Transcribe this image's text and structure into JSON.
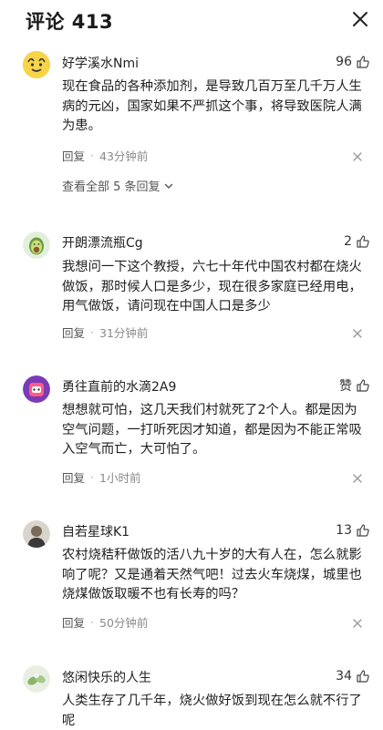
{
  "header": {
    "title": "评论 413"
  },
  "comments": [
    {
      "username": "好学溪水Nmi",
      "likes": "96",
      "text": "现在食品的各种添加剂，是导致几百万至几千万人生病的元凶，国家如果不严抓这个事，将导致医院人满为患。",
      "reply_label": "回复",
      "time": "43分钟前",
      "view_all": "查看全部 5 条回复"
    },
    {
      "username": "开朗漂流瓶Cg",
      "likes": "2",
      "text": "我想问一下这个教授，六七十年代中国农村都在烧火做饭，那时候人口是多少，现在很多家庭已经用电，用气做饭，请问现在中国人口是多少",
      "reply_label": "回复",
      "time": "31分钟前"
    },
    {
      "username": "勇往直前的水滴2A9",
      "likes": "赞",
      "text": "想想就可怕，这几天我们村就死了2个人。都是因为空气问题，一打听死因才知道，都是因为不能正常吸入空气而亡，大可怕了。",
      "reply_label": "回复",
      "time": "1小时前"
    },
    {
      "username": "自若星球K1",
      "likes": "13",
      "text": "农村烧秸秆做饭的活八九十岁的大有人在，怎么就影响了呢？又是通着天然气吧！过去火车烧煤，城里也烧煤做饭取暖不也有长寿的吗？",
      "reply_label": "回复",
      "time": "50分钟前"
    },
    {
      "username": "悠闲快乐的人生",
      "likes": "34",
      "text": "人类生存了几千年，烧火做好饭到现在怎么就不行了呢"
    }
  ]
}
